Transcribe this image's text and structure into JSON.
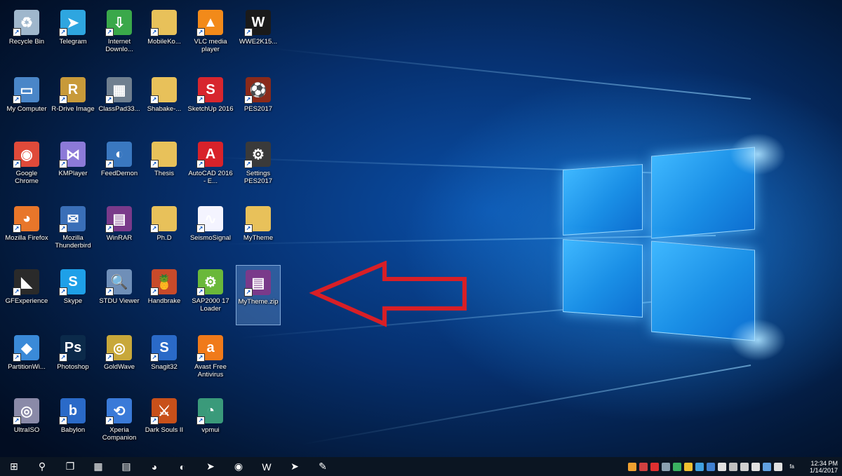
{
  "desktop": {
    "icons": [
      {
        "label": "Recycle Bin",
        "icon": "recycle-bin-icon",
        "color": "#9fb7cc",
        "glyph": "♻"
      },
      {
        "label": "Telegram",
        "icon": "telegram-icon",
        "color": "#2ea6e0",
        "glyph": "➤"
      },
      {
        "label": "Internet Downlo...",
        "icon": "internet-download-manager-icon",
        "color": "#3aa84a",
        "glyph": "⇩"
      },
      {
        "label": "MobileKo...",
        "icon": "folder-icon",
        "color": "#e8c15a",
        "glyph": ""
      },
      {
        "label": "VLC media player",
        "icon": "vlc-icon",
        "color": "#f28a1a",
        "glyph": "▲"
      },
      {
        "label": "WWE2K15...",
        "icon": "wwe-icon",
        "color": "#1a1a1a",
        "glyph": "W"
      },
      {
        "label": "My Computer",
        "icon": "my-computer-icon",
        "color": "#4a86c8",
        "glyph": "▭"
      },
      {
        "label": "R-Drive Image",
        "icon": "r-drive-image-icon",
        "color": "#c89a3a",
        "glyph": "R"
      },
      {
        "label": "ClassPad33...",
        "icon": "classpad-icon",
        "color": "#6f7f8f",
        "glyph": "▦"
      },
      {
        "label": "Shabake-...",
        "icon": "folder-icon",
        "color": "#e8c15a",
        "glyph": ""
      },
      {
        "label": "SketchUp 2016",
        "icon": "sketchup-icon",
        "color": "#d7262e",
        "glyph": "S"
      },
      {
        "label": "PES2017",
        "icon": "pes2017-icon",
        "color": "#8a2a1a",
        "glyph": "⚽"
      },
      {
        "label": "Google Chrome",
        "icon": "chrome-icon",
        "color": "#e04a3a",
        "glyph": "◉"
      },
      {
        "label": "KMPlayer",
        "icon": "kmplayer-icon",
        "color": "#8c7ad8",
        "glyph": "⋈"
      },
      {
        "label": "FeedDemon",
        "icon": "feeddemon-icon",
        "color": "#3a78c0",
        "glyph": "◐"
      },
      {
        "label": "Thesis",
        "icon": "folder-icon",
        "color": "#e8c15a",
        "glyph": ""
      },
      {
        "label": "AutoCAD 2016 - E...",
        "icon": "autocad-icon",
        "color": "#d8222a",
        "glyph": "A"
      },
      {
        "label": "Settings PES2017",
        "icon": "settings-pes2017-icon",
        "color": "#3a3a3a",
        "glyph": "⚙"
      },
      {
        "label": "Mozilla Firefox",
        "icon": "firefox-icon",
        "color": "#e8762a",
        "glyph": "◕"
      },
      {
        "label": "Mozilla Thunderbird",
        "icon": "thunderbird-icon",
        "color": "#3a6fb8",
        "glyph": "✉"
      },
      {
        "label": "WinRAR",
        "icon": "winrar-icon",
        "color": "#7a3a8a",
        "glyph": "▤"
      },
      {
        "label": "Ph.D",
        "icon": "folder-icon",
        "color": "#e8c15a",
        "glyph": ""
      },
      {
        "label": "SeismoSignal",
        "icon": "seismosignal-icon",
        "color": "#f4f4ff",
        "glyph": "∿"
      },
      {
        "label": "MyTheme",
        "icon": "mytheme-folder-icon",
        "color": "#e8c15a",
        "glyph": ""
      },
      {
        "label": "GFExperience",
        "icon": "geforce-experience-icon",
        "color": "#2a2a2a",
        "glyph": "◣"
      },
      {
        "label": "Skype",
        "icon": "skype-icon",
        "color": "#1ea0e8",
        "glyph": "S"
      },
      {
        "label": "STDU Viewer",
        "icon": "stdu-viewer-icon",
        "color": "#6f8fb8",
        "glyph": "🔍"
      },
      {
        "label": "Handbrake",
        "icon": "handbrake-icon",
        "color": "#c84a2a",
        "glyph": "🍍"
      },
      {
        "label": "SAP2000 17 Loader",
        "icon": "sap2000-icon",
        "color": "#6ab83a",
        "glyph": "⚙"
      },
      {
        "label": "MyTheme.zip",
        "icon": "winrar-archive-icon",
        "color": "#7a3a8a",
        "glyph": "▤"
      },
      {
        "label": "PartitionWi...",
        "icon": "partition-wizard-icon",
        "color": "#3a8ad8",
        "glyph": "◆"
      },
      {
        "label": "Photoshop",
        "icon": "photoshop-icon",
        "color": "#0b2a4a",
        "glyph": "Ps"
      },
      {
        "label": "GoldWave",
        "icon": "goldwave-icon",
        "color": "#c8a83a",
        "glyph": "◎"
      },
      {
        "label": "Snagit32",
        "icon": "snagit-icon",
        "color": "#2a6ac8",
        "glyph": "S"
      },
      {
        "label": "Avast Free Antivirus",
        "icon": "avast-icon",
        "color": "#f07a1a",
        "glyph": "a"
      },
      {
        "label": "UltraISO",
        "icon": "ultraiso-icon",
        "color": "#8a8aa8",
        "glyph": "◎"
      },
      {
        "label": "Babylon",
        "icon": "babylon-icon",
        "color": "#2a6ac8",
        "glyph": "b"
      },
      {
        "label": "Xperia Companion",
        "icon": "xperia-companion-icon",
        "color": "#3a7ad8",
        "glyph": "⟲"
      },
      {
        "label": "Dark Souls II",
        "icon": "dark-souls-icon",
        "color": "#c8501a",
        "glyph": "⚔"
      },
      {
        "label": "vpmui",
        "icon": "vpmui-icon",
        "color": "#3a9a7a",
        "glyph": "◔"
      }
    ]
  },
  "taskbar": {
    "pinned": [
      {
        "icon": "windows-start-icon",
        "glyph": "⊞"
      },
      {
        "icon": "search-icon",
        "glyph": "⚲"
      },
      {
        "icon": "task-view-icon",
        "glyph": "❐"
      },
      {
        "icon": "explorer-icon",
        "glyph": "▦"
      },
      {
        "icon": "file-explorer-icon",
        "glyph": "▤"
      },
      {
        "icon": "edge-icon",
        "glyph": "◕"
      },
      {
        "icon": "thunderbird-icon",
        "glyph": "◐"
      },
      {
        "icon": "telegram-icon",
        "glyph": "➤"
      },
      {
        "icon": "chrome-icon",
        "glyph": "◉"
      },
      {
        "icon": "word-icon",
        "glyph": "W"
      },
      {
        "icon": "telegram-icon",
        "glyph": "➤"
      },
      {
        "icon": "tool-icon",
        "glyph": "✎"
      }
    ],
    "tray_colors": [
      "#f0a030",
      "#d04040",
      "#e03030",
      "#8aa0b0",
      "#3ab060",
      "#f0c030",
      "#40a0e0",
      "#4080d0",
      "#e0e0e0",
      "#c0c0c0",
      "#d0d0d0",
      "#e0e0e0",
      "#60a0e0",
      "#e0e0e0"
    ],
    "language": "fa",
    "time": "12:34 PM",
    "date": "1/14/2017"
  }
}
